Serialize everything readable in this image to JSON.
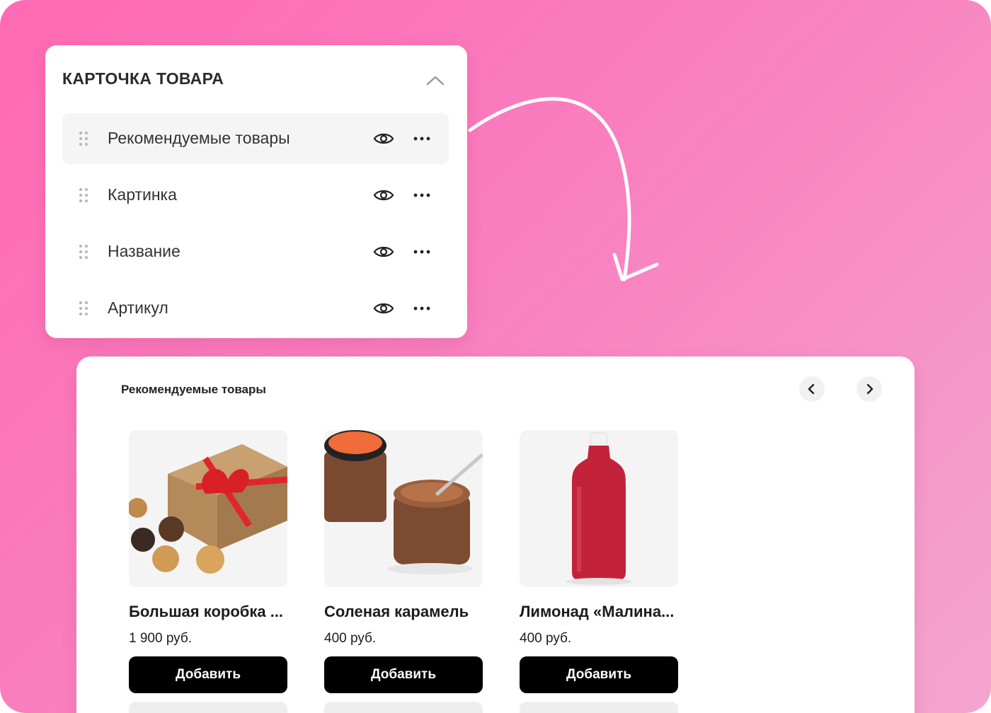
{
  "panel": {
    "title": "КАРТОЧКА ТОВАРА",
    "items": [
      {
        "label": "Рекомендуемые товары",
        "active": true
      },
      {
        "label": "Картинка",
        "active": false
      },
      {
        "label": "Название",
        "active": false
      },
      {
        "label": "Артикул",
        "active": false
      }
    ]
  },
  "block": {
    "title": "Рекомендуемые товары",
    "products": [
      {
        "name": "Большая коробка ...",
        "price": "1 900 руб.",
        "button": "Добавить",
        "image": "gift-box-with-cookies-image"
      },
      {
        "name": "Соленая карамель",
        "price": "400 руб.",
        "button": "Добавить",
        "image": "caramel-jars-image"
      },
      {
        "name": "Лимонад «Малина...",
        "price": "400 руб.",
        "button": "Добавить",
        "image": "raspberry-lemonade-bottle-image"
      }
    ]
  },
  "colors": {
    "background_from": "#ff69b4",
    "background_to": "#f4a6cf",
    "button": "#000000"
  }
}
